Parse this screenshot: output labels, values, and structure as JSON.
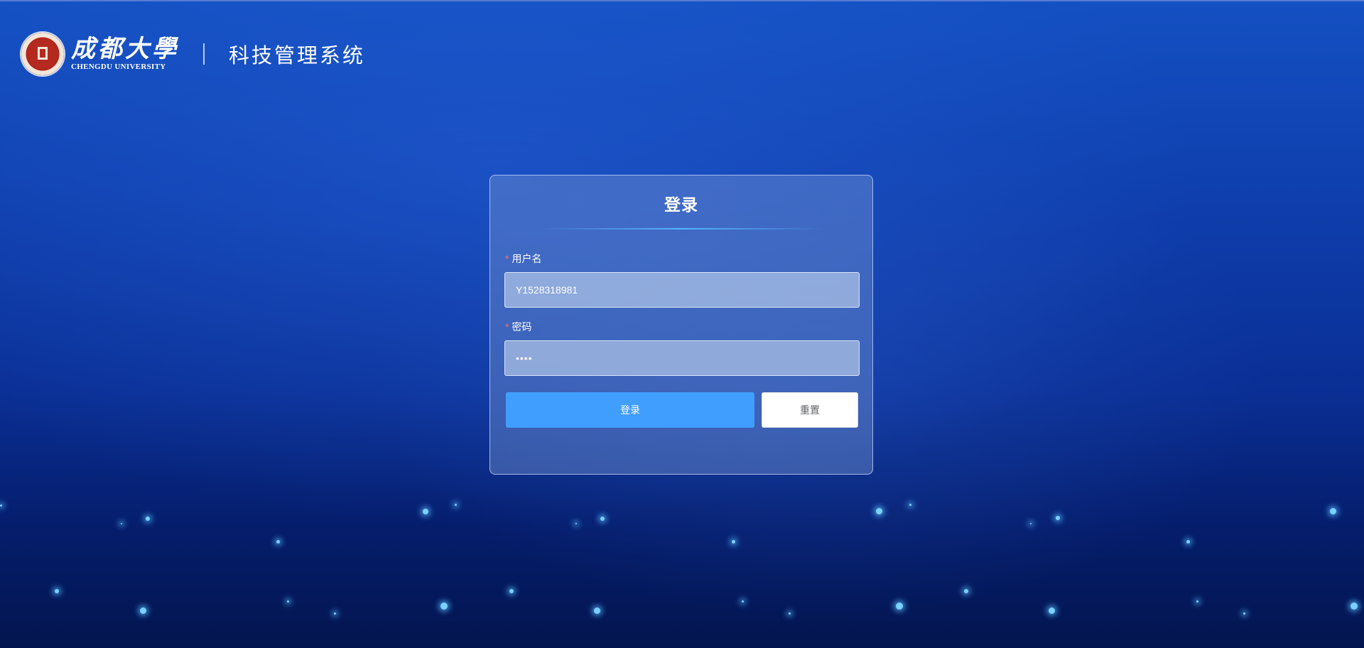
{
  "header": {
    "university_cn": "成都大學",
    "university_en": "CHENGDU UNIVERSITY",
    "system_title": "科技管理系统"
  },
  "login": {
    "title": "登录",
    "username_label": "用户名",
    "username_value": "Y1528318981",
    "password_label": "密码",
    "password_value": "••••",
    "required_mark": "*",
    "login_button": "登录",
    "reset_button": "重置"
  },
  "colors": {
    "primary": "#409eff",
    "required": "#f56c6c",
    "background_top": "#1450c2",
    "background_bottom": "#03154f"
  }
}
